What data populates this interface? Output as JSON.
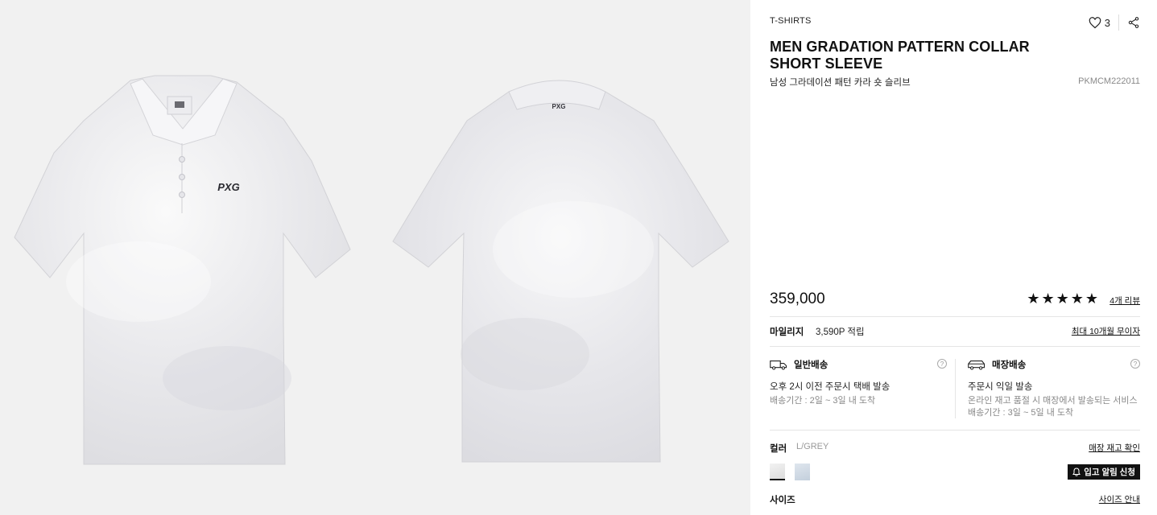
{
  "gallery": {
    "front_alt": "front view",
    "back_alt": "back view",
    "logo_text": "PXG"
  },
  "product": {
    "category": "T-SHIRTS",
    "likes": "3",
    "title": "MEN GRADATION PATTERN COLLAR SHORT SLEEVE",
    "subtitle": "남성 그라데이션 패턴 카라 숏 슬리브",
    "code": "PKMCM222011",
    "price": "359,000",
    "rating_stars": "★★★★★",
    "review_link": "4개 리뷰"
  },
  "mileage": {
    "label": "마일리지",
    "value": "3,590P 적립",
    "installment": "최대 10개월 무이자"
  },
  "shipping": {
    "general": {
      "title": "일반배송",
      "line": "오후 2시 이전 주문시 택배 발송",
      "sub": "배송기간 : 2일 ~ 3일 내 도착"
    },
    "store": {
      "title": "매장배송",
      "line": "주문시 익일 발송",
      "sub1": "온라인 재고 품절 시 매장에서 발송되는 서비스",
      "sub2": "배송기간 : 3일 ~ 5일 내 도착"
    },
    "help": "?"
  },
  "options": {
    "color_label": "컬러",
    "color_value": "L/GREY",
    "stock_link": "매장 재고 확인",
    "notify_button": "입고 알림 신청",
    "size_label": "사이즈",
    "size_guide": "사이즈 안내"
  },
  "colors": {
    "accent": "#111111",
    "gallery_bg": "#f1f1f1",
    "swatch_grey": "#dcdcdc",
    "swatch_blue": "#c3cfdc"
  }
}
